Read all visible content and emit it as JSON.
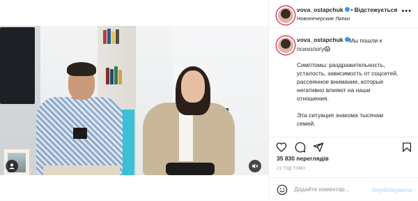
{
  "header": {
    "username": "vova_ostapchuk",
    "follow_label": "Відстежується",
    "location": "Новопечерские Липки",
    "more": "•••"
  },
  "caption": {
    "username": "vova_ostapchuk",
    "line1": "Мы пошли к психологу😱",
    "para1": "Симптомы: раздражительность, усталость, зависимость от соцсетей, рассеянное внимание, которые негативно влияют на наши отношения.",
    "para2": "Эта ситуация знакома тысячам семей."
  },
  "stats": {
    "views": "35 830 переглядів",
    "time_ago": "21 ГОД ТОМУ"
  },
  "comment": {
    "placeholder": "Додайте коментар...",
    "publish_label": "Опублікувати"
  },
  "icons": {
    "verified": "verified-badge-icon",
    "like": "heart-icon",
    "comment": "comment-bubble-icon",
    "share": "paper-plane-icon",
    "save": "bookmark-icon",
    "emoji": "smiley-icon",
    "user_tag": "user-tag-icon",
    "mute": "speaker-muted-icon"
  },
  "colors": {
    "accent_blue": "#3897f0",
    "publish_disabled": "#b2dffc"
  }
}
